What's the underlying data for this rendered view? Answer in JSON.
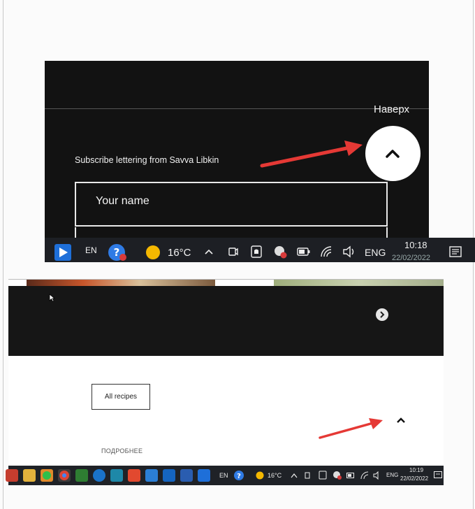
{
  "screenshot_top": {
    "to_top_label": "Наверх",
    "subscribe_text": "Subscribe lettering from Savva Libkin",
    "name_placeholder": "Your name",
    "taskbar": {
      "language": "EN",
      "temperature": "16°C",
      "input_language": "ENG",
      "time": "10:18",
      "date": "22/02/2022"
    }
  },
  "screenshot_bottom": {
    "all_recipes_label": "All recipes",
    "more_link": "ПОДРОБНЕЕ",
    "taskbar": {
      "language": "EN",
      "temperature": "16°C",
      "input_language": "ENG",
      "time": "10:19",
      "date": "22/02/2022"
    }
  },
  "colors": {
    "arrow": "#e53935",
    "dark_bg": "#121212",
    "taskbar": "#1d1f24"
  }
}
